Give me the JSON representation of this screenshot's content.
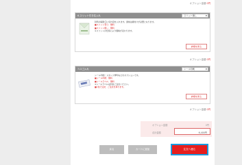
{
  "fees": {
    "top": {
      "label": "オプション金額",
      "value": "0",
      "unit": "円"
    },
    "card1": {
      "label": "オプション金額",
      "value": "0",
      "unit": "円"
    },
    "card2": {
      "label": "オプション金額",
      "value": "0",
      "unit": "円"
    }
  },
  "card1": {
    "title": "6.スリット付き名入れ",
    "select_value": "スリット無し",
    "description": "封筒の開封口に切れ目を入れます。通常は糊付けが必要となります。",
    "red_line_1": "■スリット有り：無料",
    "red_line_2": "■スリット無し：無料",
    "note": "※スリットの仕様により価格が変わります。",
    "detail_button": "詳細を見る"
  },
  "card2": {
    "title": "7.ロゴ入れ",
    "select_value": "シール印刷",
    "description": "シール印刷・スタンプ押印などのオプションです。",
    "red_line_1": "■シール印刷：無料",
    "red_line_2": "■シールラベル：無料",
    "red_line_3": "■1色で注文：ご注文を承ります。",
    "note": "※シールラベルは別途ご注文ください。",
    "detail_button": "詳細を見る"
  },
  "totals": {
    "option_label": "オプション金額",
    "option_value": "0円",
    "total_label": "合計金額",
    "total_value": "6,400円"
  },
  "actions": {
    "back": "戻る",
    "cart": "カートに追加",
    "order": "注文へ進む"
  },
  "colors": {
    "accent": "#e61e1e",
    "focus_outline": "#1a9be0"
  }
}
